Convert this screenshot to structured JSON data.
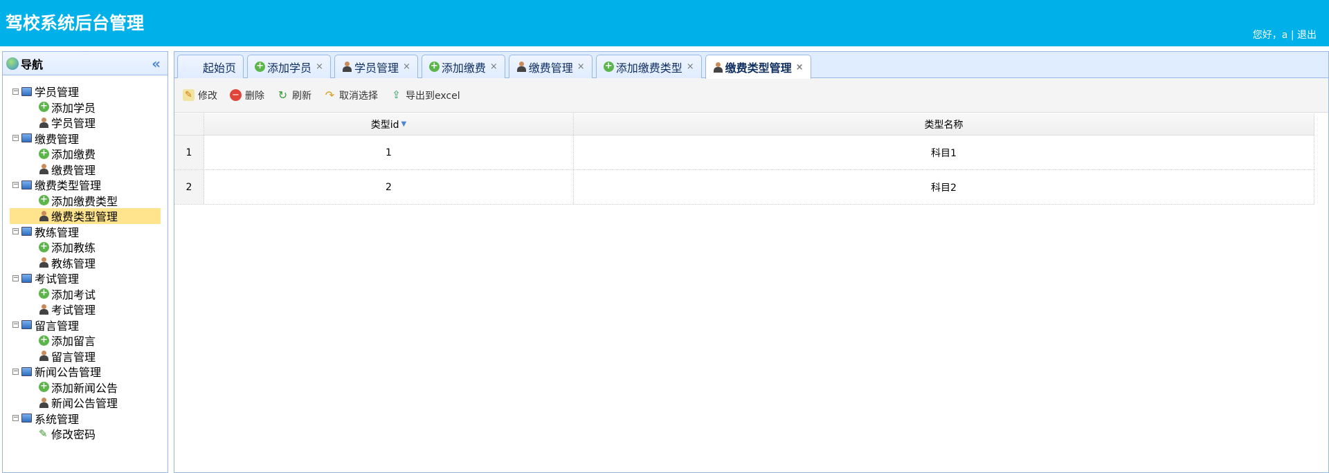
{
  "header": {
    "title": "驾校系统后台管理",
    "greeting": "您好，a",
    "separator": "|",
    "logout": "退出"
  },
  "sidebar": {
    "title": "导航",
    "collapse_icon": "«",
    "groups": [
      {
        "label": "学员管理",
        "items": [
          {
            "label": "添加学员",
            "icon": "add"
          },
          {
            "label": "学员管理",
            "icon": "user"
          }
        ]
      },
      {
        "label": "缴费管理",
        "items": [
          {
            "label": "添加缴费",
            "icon": "add"
          },
          {
            "label": "缴费管理",
            "icon": "user"
          }
        ]
      },
      {
        "label": "缴费类型管理",
        "items": [
          {
            "label": "添加缴费类型",
            "icon": "add"
          },
          {
            "label": "缴费类型管理",
            "icon": "user",
            "selected": true
          }
        ]
      },
      {
        "label": "教练管理",
        "items": [
          {
            "label": "添加教练",
            "icon": "add"
          },
          {
            "label": "教练管理",
            "icon": "user"
          }
        ]
      },
      {
        "label": "考试管理",
        "items": [
          {
            "label": "添加考试",
            "icon": "add"
          },
          {
            "label": "考试管理",
            "icon": "user"
          }
        ]
      },
      {
        "label": "留言管理",
        "items": [
          {
            "label": "添加留言",
            "icon": "add"
          },
          {
            "label": "留言管理",
            "icon": "user"
          }
        ]
      },
      {
        "label": "新闻公告管理",
        "items": [
          {
            "label": "添加新闻公告",
            "icon": "add"
          },
          {
            "label": "新闻公告管理",
            "icon": "user"
          }
        ]
      },
      {
        "label": "系统管理",
        "items": [
          {
            "label": "修改密码",
            "icon": "pencil"
          }
        ]
      }
    ]
  },
  "tabs": [
    {
      "label": "起始页",
      "icon": "none",
      "closable": false
    },
    {
      "label": "添加学员",
      "icon": "add",
      "closable": true
    },
    {
      "label": "学员管理",
      "icon": "user",
      "closable": true
    },
    {
      "label": "添加缴费",
      "icon": "add",
      "closable": true
    },
    {
      "label": "缴费管理",
      "icon": "user",
      "closable": true
    },
    {
      "label": "添加缴费类型",
      "icon": "add",
      "closable": true
    },
    {
      "label": "缴费类型管理",
      "icon": "user",
      "closable": true,
      "active": true
    }
  ],
  "toolbar": {
    "edit": "修改",
    "delete": "删除",
    "refresh": "刷新",
    "cancel": "取消选择",
    "export": "导出到excel"
  },
  "table": {
    "columns": [
      "类型id",
      "类型名称"
    ],
    "rows": [
      {
        "n": "1",
        "id": "1",
        "name": "科目1"
      },
      {
        "n": "2",
        "id": "2",
        "name": "科目2"
      }
    ]
  }
}
